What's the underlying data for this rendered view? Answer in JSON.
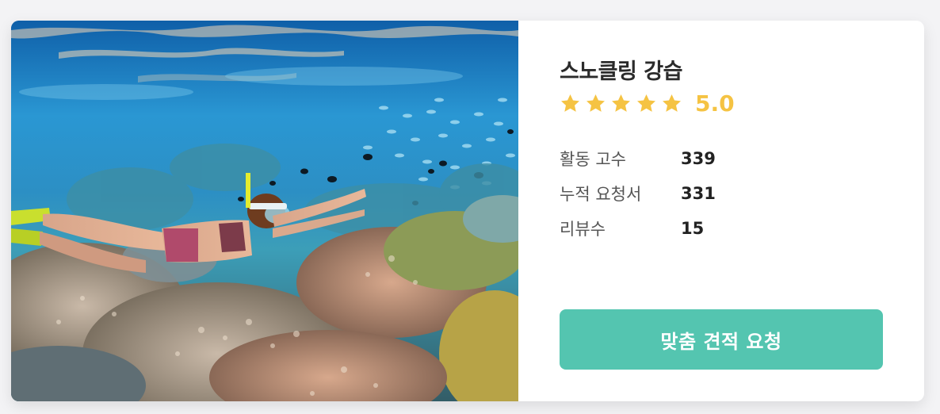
{
  "card": {
    "photo_alt": "snorkeling-photo",
    "title": "스노클링 강습",
    "rating": {
      "stars": 5,
      "max_stars": 5,
      "score": "5.0",
      "star_color": "#f5c343"
    },
    "stats": [
      {
        "label": "활동 고수",
        "value": "339"
      },
      {
        "label": "누적 요청서",
        "value": "331"
      },
      {
        "label": "리뷰수",
        "value": "15"
      }
    ],
    "cta_label": "맞춤 견적 요청",
    "cta_color": "#54c5b0"
  }
}
